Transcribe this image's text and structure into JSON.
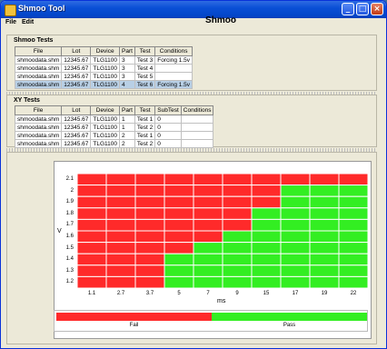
{
  "window": {
    "title": "Shmoo Tool"
  },
  "menu": [
    "File",
    "Edit"
  ],
  "shmoo_tests": {
    "title": "Shmoo Tests",
    "columns": [
      "File",
      "Lot",
      "Device",
      "Part",
      "Test",
      "Conditions"
    ],
    "rows": [
      [
        "shmoodata.shm",
        "12345.67",
        "TLG1100",
        "3",
        "Test 3",
        "Forcing 1.5v"
      ],
      [
        "shmoodata.shm",
        "12345.67",
        "TLG1100",
        "3",
        "Test 4",
        ""
      ],
      [
        "shmoodata.shm",
        "12345.67",
        "TLG1100",
        "3",
        "Test 5",
        ""
      ],
      [
        "shmoodata.shm",
        "12345.67",
        "TLG1100",
        "4",
        "Test 6",
        "Forcing 1.5v"
      ]
    ],
    "selected_row": 3
  },
  "xy_tests": {
    "title": "XY Tests",
    "columns": [
      "File",
      "Lot",
      "Device",
      "Part",
      "Test",
      "SubTest",
      "Conditions"
    ],
    "rows": [
      [
        "shmoodata.shm",
        "12345.67",
        "TLG1100",
        "1",
        "Test 1",
        "0",
        ""
      ],
      [
        "shmoodata.shm",
        "12345.67",
        "TLG1100",
        "1",
        "Test 2",
        "0",
        ""
      ],
      [
        "shmoodata.shm",
        "12345.67",
        "TLG1100",
        "2",
        "Test 1",
        "0",
        ""
      ],
      [
        "shmoodata.shm",
        "12345.67",
        "TLG1100",
        "2",
        "Test 2",
        "0",
        ""
      ]
    ]
  },
  "chart_data": {
    "type": "heatmap",
    "title": "Shmoo",
    "xlabel": "ms",
    "ylabel": "V",
    "x": [
      "1.1",
      "2.7",
      "3.7",
      "5",
      "7",
      "9",
      "15",
      "17",
      "19",
      "22"
    ],
    "y": [
      "2.1",
      "2",
      "1.9",
      "1.8",
      "1.7",
      "1.6",
      "1.5",
      "1.4",
      "1.3",
      "1.2"
    ],
    "values": [
      [
        0,
        0,
        0,
        0,
        0,
        0,
        0,
        0,
        0,
        0
      ],
      [
        0,
        0,
        0,
        0,
        0,
        0,
        0,
        1,
        1,
        1
      ],
      [
        0,
        0,
        0,
        0,
        0,
        0,
        0,
        1,
        1,
        1
      ],
      [
        0,
        0,
        0,
        0,
        0,
        0,
        1,
        1,
        1,
        1
      ],
      [
        0,
        0,
        0,
        0,
        0,
        0,
        1,
        1,
        1,
        1
      ],
      [
        0,
        0,
        0,
        0,
        0,
        1,
        1,
        1,
        1,
        1
      ],
      [
        0,
        0,
        0,
        0,
        1,
        1,
        1,
        1,
        1,
        1
      ],
      [
        0,
        0,
        0,
        1,
        1,
        1,
        1,
        1,
        1,
        1
      ],
      [
        0,
        0,
        0,
        1,
        1,
        1,
        1,
        1,
        1,
        1
      ],
      [
        0,
        0,
        0,
        1,
        1,
        1,
        1,
        1,
        1,
        1
      ]
    ],
    "colors": {
      "fail": "#ff2a2a",
      "pass": "#33ee22"
    },
    "legend": {
      "fail_label": "Fail",
      "pass_label": "Pass",
      "fail_fraction": 0.5
    }
  }
}
